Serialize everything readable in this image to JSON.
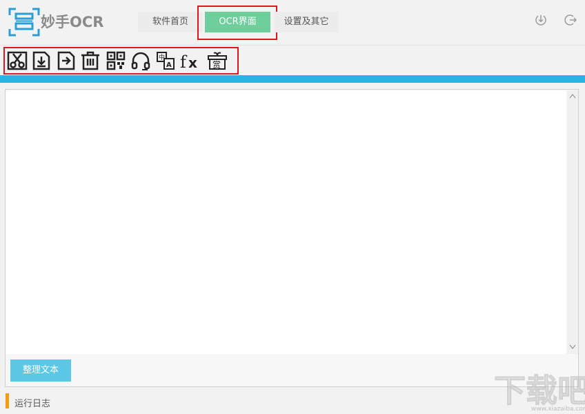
{
  "header": {
    "app_name": "妙手OCR",
    "tabs": [
      {
        "label": "软件首页",
        "active": false
      },
      {
        "label": "OCR界面",
        "active": true
      },
      {
        "label": "设置及其它",
        "active": false
      }
    ],
    "right_icons": [
      "download-icon",
      "logout-icon"
    ]
  },
  "toolbar": {
    "tools": [
      {
        "icon": "scissors-icon"
      },
      {
        "icon": "import-file-icon"
      },
      {
        "icon": "export-file-icon"
      },
      {
        "icon": "trash-icon"
      },
      {
        "icon": "qr-code-icon"
      },
      {
        "icon": "headphones-icon"
      },
      {
        "icon": "translate-icon"
      },
      {
        "icon": "formula-icon"
      },
      {
        "icon": "gift-icon",
        "text": "赏"
      }
    ]
  },
  "editor": {
    "text": "",
    "tidy_button_label": "整理文本"
  },
  "log": {
    "label": "运行日志"
  },
  "watermark": {
    "text": "下载吧",
    "url": "www.xiazaiba.com"
  },
  "colors": {
    "accent_green": "#6fcf9c",
    "accent_blue": "#29b6e1",
    "button_blue": "#5dc7e8",
    "log_marker_orange": "#f39c12",
    "highlight_red": "#e0141e",
    "logo_blue": "#2a9fd6"
  }
}
